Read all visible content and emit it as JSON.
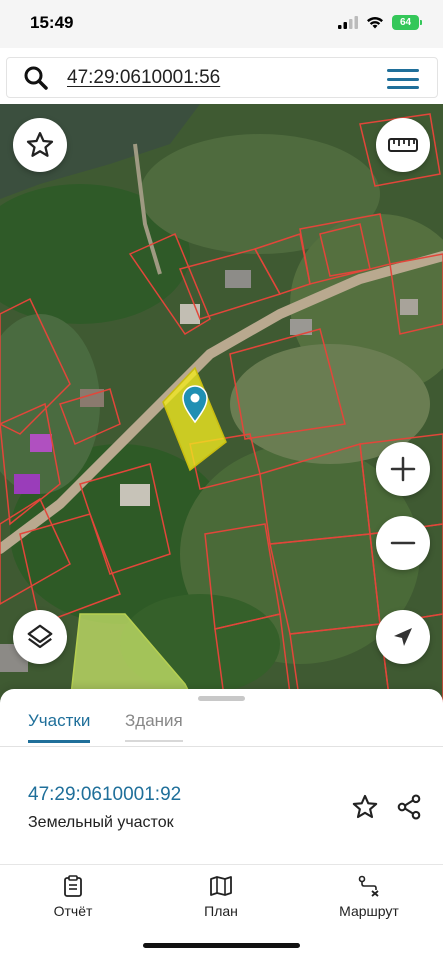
{
  "status": {
    "time": "15:49",
    "battery": "64"
  },
  "search": {
    "value": "47:29:0610001:56"
  },
  "tabs": {
    "active": "Участки",
    "inactive": "Здания"
  },
  "parcel": {
    "id": "47:29:0610001:92",
    "type": "Земельный участок"
  },
  "nav": {
    "report": "Отчёт",
    "plan": "План",
    "route": "Маршрут"
  },
  "colors": {
    "accent": "#1f6f9a",
    "parcel_border": "#e2463a",
    "selected_parcel": "#f2ea1f",
    "battery": "#34c759"
  }
}
